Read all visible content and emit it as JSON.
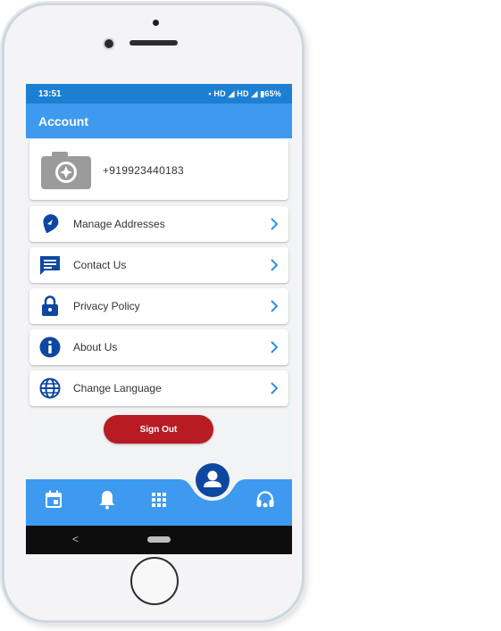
{
  "status_bar": {
    "time": "13:51",
    "indicators": "• HD ◢ HD ◢ ▮65%"
  },
  "app_bar": {
    "title": "Account"
  },
  "profile": {
    "phone": "+919923440183",
    "avatar_icon": "camera-icon"
  },
  "menu": [
    {
      "label": "Manage Addresses",
      "icon": "location-pin-icon"
    },
    {
      "label": "Contact Us",
      "icon": "chat-icon"
    },
    {
      "label": "Privacy Policy",
      "icon": "lock-icon"
    },
    {
      "label": "About Us",
      "icon": "info-icon"
    },
    {
      "label": "Change Language",
      "icon": "globe-icon"
    }
  ],
  "sign_out_label": "Sign Out",
  "bottom_nav": [
    {
      "icon": "calendar-icon"
    },
    {
      "icon": "bell-icon"
    },
    {
      "icon": "grid-icon"
    },
    {
      "icon": "account-icon",
      "active": true
    },
    {
      "icon": "headset-icon"
    }
  ],
  "android_nav": {
    "back_label": "<"
  },
  "colors": {
    "status_bar": "#1d7fd2",
    "app_bar": "#3d9aee",
    "nav_bar": "#3d9aee",
    "icon_dark_blue": "#0d47a1",
    "chevron": "#2d8fe6",
    "sign_out": "#b81c22",
    "active_nav": "#0d47a1"
  }
}
